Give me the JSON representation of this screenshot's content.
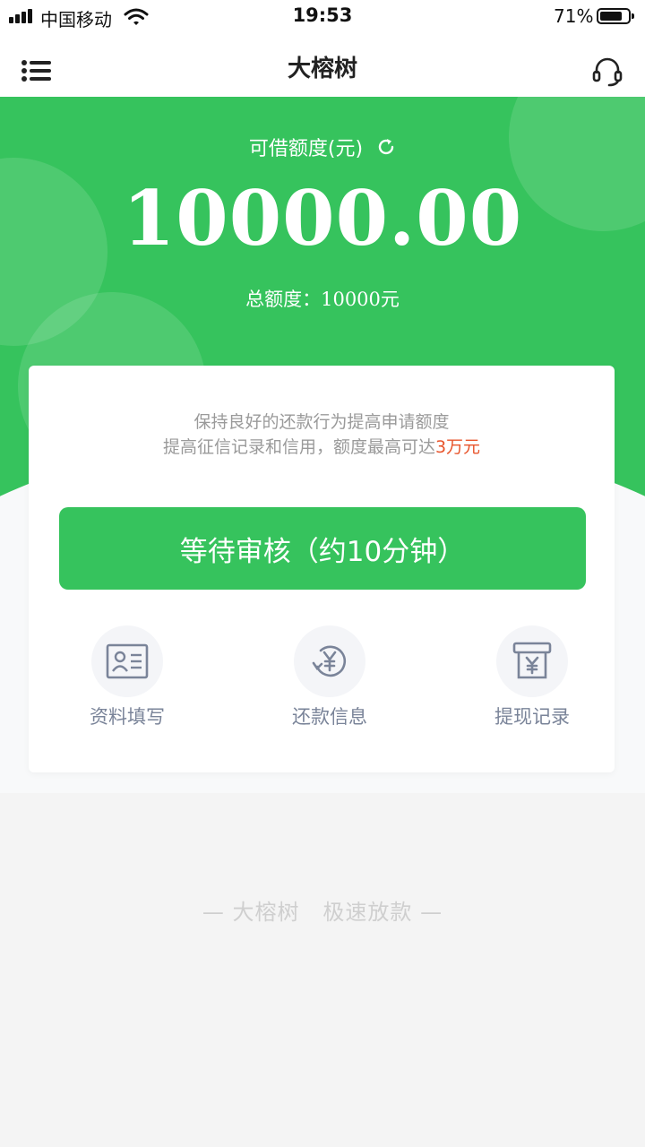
{
  "status_bar": {
    "carrier": "中国移动",
    "time": "19:53",
    "battery_percent": "71%",
    "battery_level": 0.71
  },
  "nav": {
    "title": "大榕树",
    "left_icon": "menu-icon",
    "right_icon": "headset-icon"
  },
  "hero": {
    "available_label": "可借额度(元)",
    "amount": "10000.00",
    "total_label": "总额度：",
    "total_value": "10000元",
    "refresh_icon": "refresh-icon"
  },
  "card": {
    "tip_line1": "保持良好的还款行为提高申请额度",
    "tip_line2_prefix": "提高征信记录和信用，额度最高可达",
    "tip_line2_highlight": "3万元",
    "action_button": "等待审核（约10分钟）",
    "features": [
      {
        "label": "资料填写",
        "icon": "id-card-icon"
      },
      {
        "label": "还款信息",
        "icon": "yuan-refresh-icon"
      },
      {
        "label": "提现记录",
        "icon": "yuan-receipt-icon"
      }
    ]
  },
  "footer": {
    "slogan": "— 大榕树   极速放款 —"
  },
  "colors": {
    "primary_green": "#36c35d",
    "highlight_orange": "#e8552c",
    "icon_gray": "#7a8499"
  }
}
